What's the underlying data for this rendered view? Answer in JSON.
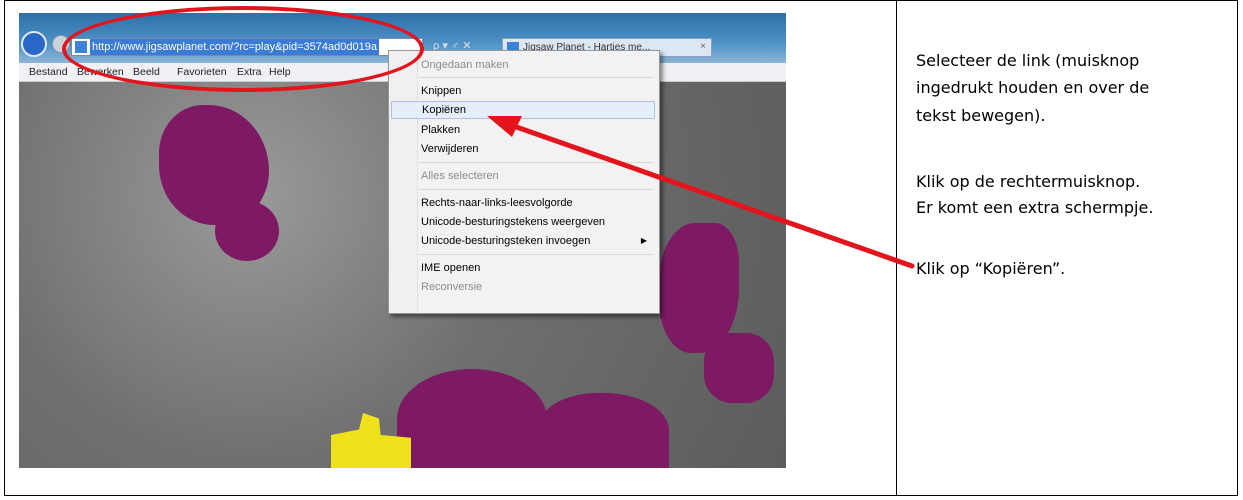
{
  "browser": {
    "url": "http://www.jigsawplanet.com/?rc=play&pid=3574ad0d019a",
    "address_controls": "ρ ▾ ♂ ✕",
    "tab_title": "Jigsaw Planet - Hartjes me...",
    "tab_close": "×",
    "menu": [
      "Bestand",
      "Bewerken",
      "Beeld",
      "Favorieten",
      "Extra",
      "Help"
    ]
  },
  "context_menu": {
    "items": [
      {
        "label": "Ongedaan maken",
        "disabled": true
      },
      {
        "label": "Knippen",
        "disabled": false
      },
      {
        "label": "Kopiëren",
        "disabled": false,
        "selected": true
      },
      {
        "label": "Plakken",
        "disabled": false
      },
      {
        "label": "Verwijderen",
        "disabled": false
      },
      {
        "label": "Alles selecteren",
        "disabled": true
      },
      {
        "label": "Rechts-naar-links-leesvolgorde",
        "disabled": false
      },
      {
        "label": "Unicode-besturingstekens weergeven",
        "disabled": false
      },
      {
        "label": "Unicode-besturingsteken invoegen",
        "disabled": false,
        "submenu": "▶"
      },
      {
        "label": "IME openen",
        "disabled": false
      },
      {
        "label": "Reconversie",
        "disabled": true
      }
    ]
  },
  "instructions": {
    "line1": "Selecteer de link (muisknop",
    "line2": "ingedrukt houden en over de",
    "line3": "tekst bewegen).",
    "line4": "Klik op de rechtermuisknop.",
    "line5": "Er komt een extra schermpje.",
    "line6": "Klik op “Kopiëren”."
  },
  "colors": {
    "annotation_red": "#e3141b",
    "piece_purple": "#7d1a63"
  }
}
